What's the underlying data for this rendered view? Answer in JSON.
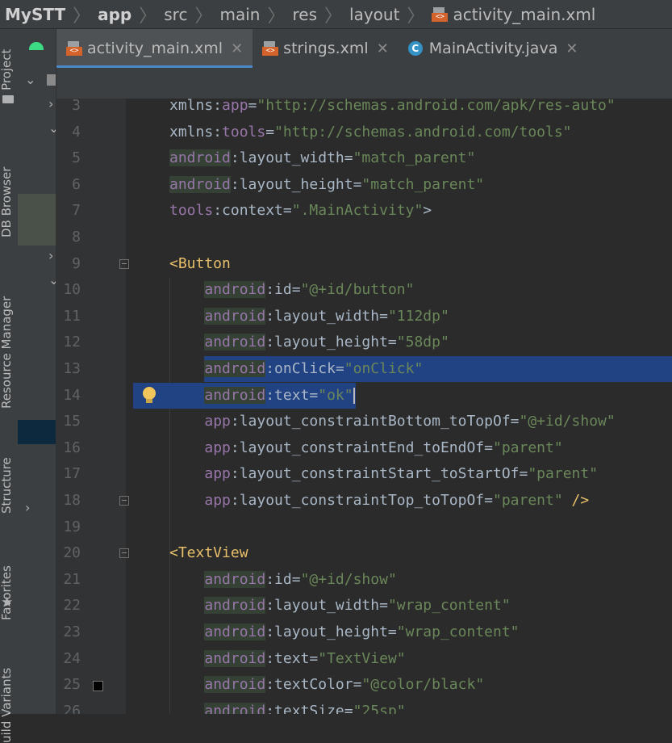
{
  "breadcrumb": {
    "items": [
      "MySTT",
      "app",
      "src",
      "main",
      "res",
      "layout",
      "activity_main.xml"
    ]
  },
  "tool_window_tabs": [
    "Project",
    "DB Browser",
    "Resource Manager",
    "Structure",
    "Favorites",
    "uild Variants"
  ],
  "editor_tabs": [
    {
      "label": "activity_main.xml",
      "active": true,
      "icon": "xml-file-icon"
    },
    {
      "label": "strings.xml",
      "active": false,
      "icon": "xml-file-icon"
    },
    {
      "label": "MainActivity.java",
      "active": false,
      "icon": "java-class-icon"
    }
  ],
  "code_lines": [
    {
      "n": "3",
      "tokens": [
        [
          "plain",
          "xmlns:"
        ],
        [
          "nsp",
          "app"
        ],
        [
          "plain",
          "="
        ],
        [
          "val",
          "\"http://schemas.android.com/apk/res-auto\""
        ]
      ]
    },
    {
      "n": "4",
      "tokens": [
        [
          "plain",
          "xmlns:"
        ],
        [
          "nsp",
          "tools"
        ],
        [
          "plain",
          "="
        ],
        [
          "val",
          "\"http://schemas.android.com/tools\""
        ]
      ]
    },
    {
      "n": "5",
      "tokens": [
        [
          "ns",
          "android"
        ],
        [
          "plain",
          ":layout_width="
        ],
        [
          "val",
          "\"match_parent\""
        ]
      ]
    },
    {
      "n": "6",
      "tokens": [
        [
          "ns",
          "android"
        ],
        [
          "plain",
          ":layout_height="
        ],
        [
          "val",
          "\"match_parent\""
        ]
      ]
    },
    {
      "n": "7",
      "tokens": [
        [
          "nsp",
          "tools"
        ],
        [
          "plain",
          ":context="
        ],
        [
          "val",
          "\".MainActivity\""
        ],
        [
          "plain",
          ">"
        ]
      ]
    },
    {
      "n": "8",
      "tokens": []
    },
    {
      "n": "9",
      "tokens": [
        [
          "tag",
          "<Button"
        ]
      ]
    },
    {
      "n": "10",
      "tokens": [
        [
          "plain",
          "    "
        ],
        [
          "ns",
          "android"
        ],
        [
          "plain",
          ":id="
        ],
        [
          "val",
          "\"@+id/button\""
        ]
      ]
    },
    {
      "n": "11",
      "tokens": [
        [
          "plain",
          "    "
        ],
        [
          "ns",
          "android"
        ],
        [
          "plain",
          ":layout_width="
        ],
        [
          "val",
          "\"112dp\""
        ]
      ]
    },
    {
      "n": "12",
      "tokens": [
        [
          "plain",
          "    "
        ],
        [
          "ns",
          "android"
        ],
        [
          "plain",
          ":layout_height="
        ],
        [
          "val",
          "\"58dp\""
        ]
      ]
    },
    {
      "n": "13",
      "tokens": [
        [
          "plain",
          "    "
        ],
        [
          "ns",
          "android"
        ],
        [
          "plain",
          ":onClick="
        ],
        [
          "val",
          "\"onClick\""
        ]
      ]
    },
    {
      "n": "14",
      "tokens": [
        [
          "plain",
          "    "
        ],
        [
          "ns",
          "android"
        ],
        [
          "plain",
          ":text="
        ],
        [
          "val",
          "\"ok\""
        ]
      ]
    },
    {
      "n": "15",
      "tokens": [
        [
          "plain",
          "    "
        ],
        [
          "nsp",
          "app"
        ],
        [
          "plain",
          ":layout_constraintBottom_toTopOf="
        ],
        [
          "val",
          "\"@+id/show\""
        ]
      ]
    },
    {
      "n": "16",
      "tokens": [
        [
          "plain",
          "    "
        ],
        [
          "nsp",
          "app"
        ],
        [
          "plain",
          ":layout_constraintEnd_toEndOf="
        ],
        [
          "val",
          "\"parent\""
        ]
      ]
    },
    {
      "n": "17",
      "tokens": [
        [
          "plain",
          "    "
        ],
        [
          "nsp",
          "app"
        ],
        [
          "plain",
          ":layout_constraintStart_toStartOf="
        ],
        [
          "val",
          "\"parent\""
        ]
      ]
    },
    {
      "n": "18",
      "tokens": [
        [
          "plain",
          "    "
        ],
        [
          "nsp",
          "app"
        ],
        [
          "plain",
          ":layout_constraintTop_toTopOf="
        ],
        [
          "val",
          "\"parent\""
        ],
        [
          "plain",
          " "
        ],
        [
          "tag",
          "/>"
        ]
      ]
    },
    {
      "n": "19",
      "tokens": []
    },
    {
      "n": "20",
      "tokens": [
        [
          "tag",
          "<TextView"
        ]
      ]
    },
    {
      "n": "21",
      "tokens": [
        [
          "plain",
          "    "
        ],
        [
          "ns",
          "android"
        ],
        [
          "plain",
          ":id="
        ],
        [
          "val",
          "\"@+id/show\""
        ]
      ]
    },
    {
      "n": "22",
      "tokens": [
        [
          "plain",
          "    "
        ],
        [
          "ns",
          "android"
        ],
        [
          "plain",
          ":layout_width="
        ],
        [
          "val",
          "\"wrap_content\""
        ]
      ]
    },
    {
      "n": "23",
      "tokens": [
        [
          "plain",
          "    "
        ],
        [
          "ns",
          "android"
        ],
        [
          "plain",
          ":layout_height="
        ],
        [
          "val",
          "\"wrap_content\""
        ]
      ]
    },
    {
      "n": "24",
      "tokens": [
        [
          "plain",
          "    "
        ],
        [
          "ns",
          "android"
        ],
        [
          "plain",
          ":text="
        ],
        [
          "val",
          "\"TextView\""
        ]
      ]
    },
    {
      "n": "25",
      "tokens": [
        [
          "plain",
          "    "
        ],
        [
          "ns",
          "android"
        ],
        [
          "plain",
          ":textColor="
        ],
        [
          "val",
          "\"@color/black\""
        ]
      ]
    },
    {
      "n": "26",
      "tokens": [
        [
          "plain",
          "    "
        ],
        [
          "ns",
          "android"
        ],
        [
          "plain",
          ":textSize="
        ],
        [
          "val",
          "\"25sp\""
        ]
      ]
    }
  ],
  "colors": {
    "selection": "#214283",
    "accent": "#4a88c7"
  }
}
